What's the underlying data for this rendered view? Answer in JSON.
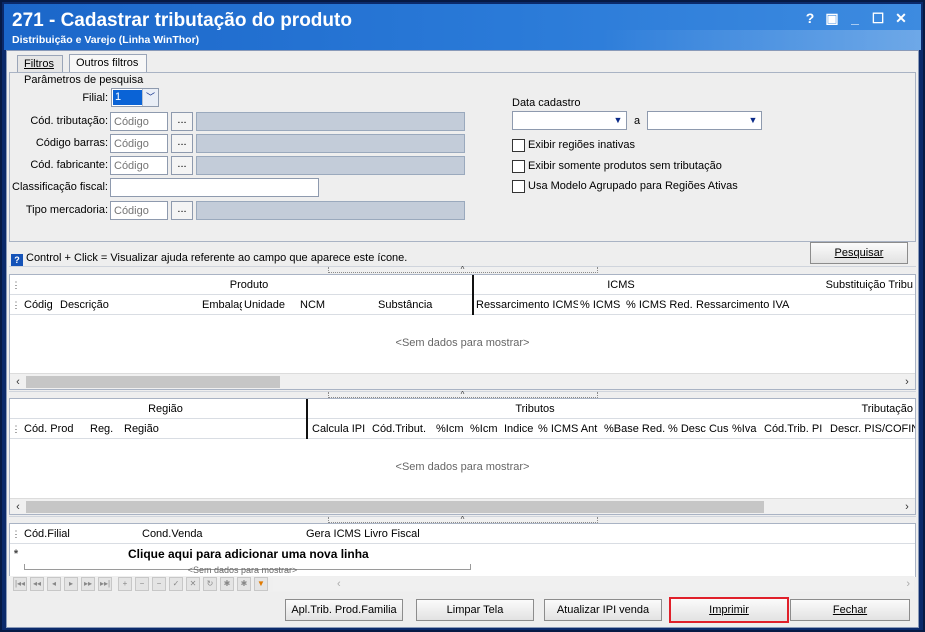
{
  "window": {
    "title": "271 - Cadastrar tributação do produto",
    "subtitle": "Distribuição e Varejo (Linha WinThor)",
    "controls": {
      "help": "?",
      "restore": "▣",
      "minimize": "_",
      "maximize": "☐",
      "close": "✕"
    }
  },
  "tabs": [
    {
      "label": "Filtros"
    },
    {
      "label": "Outros filtros"
    }
  ],
  "search": {
    "group_caption": "Parâmetros de pesquisa",
    "filial": {
      "label": "Filial:",
      "value": "1"
    },
    "cod_tributacao": {
      "label": "Cód. tributação:",
      "placeholder": "Código"
    },
    "codigo_barras": {
      "label": "Código barras:",
      "placeholder": "Código"
    },
    "cod_fabricante": {
      "label": "Cód. fabricante:",
      "placeholder": "Código"
    },
    "classificacao_fiscal": {
      "label": "Classificação fiscal:",
      "value": ""
    },
    "tipo_mercadoria": {
      "label": "Tipo mercadoria:",
      "placeholder": "Código"
    },
    "ellipsis": "...",
    "data_cadastro": {
      "label": "Data cadastro",
      "separator": "a"
    },
    "checkboxes": [
      {
        "label": "Exibir regiões inativas",
        "checked": false
      },
      {
        "label": "Exibir somente produtos sem tributação",
        "checked": false
      },
      {
        "label": "Usa Modelo Agrupado para Regiões Ativas",
        "checked": false
      }
    ],
    "help_text": "Control + Click = Visualizar ajuda referente ao campo que aparece este ícone.",
    "pesquisar_label": "Pesquisar"
  },
  "grid_products": {
    "bands": [
      "Produto",
      "ICMS",
      "Substituição Tribu"
    ],
    "columns": [
      "Códig",
      "Descrição",
      "Embalag",
      "Unidade",
      "NCM",
      "Substância",
      "Ressarcimento ICMS",
      "% ICMS",
      "% ICMS Red.",
      "Ressarcimento IVA"
    ],
    "empty_text": "<Sem dados para mostrar>"
  },
  "grid_regions": {
    "bands": [
      "Região",
      "Tributos",
      "Tributação"
    ],
    "columns": [
      "Cód. Prod",
      "Reg.",
      "Região",
      "Calcula IPI",
      "Cód.Tribut.",
      "%Icm",
      "%Icm",
      "Indice",
      "% ICMS Ant",
      "%Base Red.",
      "% Desc Cus",
      "%Iva",
      "Cód.Trib. PI",
      "Descr. PIS/COFIN"
    ],
    "empty_text": "<Sem dados para mostrar>"
  },
  "grid_filial": {
    "columns": [
      "Cód.Filial",
      "Cond.Venda",
      "Gera ICMS Livro Fiscal"
    ],
    "new_row_marker": "*",
    "new_row_text": "Clique aqui para adicionar uma nova linha",
    "empty_text": "<Sem dados para mostrar>"
  },
  "navigator": [
    "|◂◂",
    "◂◂",
    "◂",
    "▸",
    "▸▸",
    "▸▸|",
    "+",
    "−",
    "−",
    "✓",
    "✕",
    "↻",
    "✱",
    "✱",
    "▼"
  ],
  "footer_buttons": {
    "apl_trib": "Apl.Trib. Prod.Familia",
    "limpar": "Limpar Tela",
    "atualizar": "Atualizar IPI venda",
    "imprimir": "Imprimir",
    "fechar": "Fechar"
  },
  "colors": {
    "title_bar": "#1b66c9",
    "highlight_border": "#e0202a",
    "selection": "#0a63d6"
  }
}
